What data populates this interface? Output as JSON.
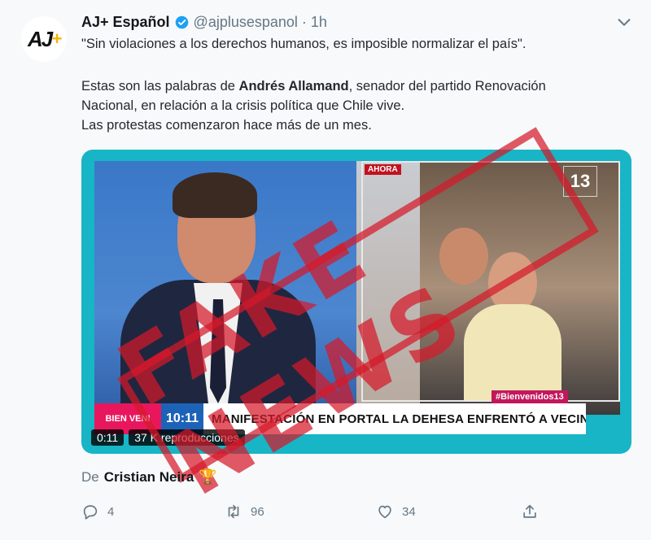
{
  "tweet": {
    "author_name": "AJ+ Español",
    "handle": "@ajplusespanol",
    "separator": "·",
    "time": "1h",
    "avatar_text": "AJ",
    "avatar_plus": "+",
    "line1": "\"Sin violaciones a los derechos humanos, es imposible normalizar el país\".",
    "line2_pre": "Estas son las palabras de ",
    "line2_bold": "Andrés Allamand",
    "line2_post": ", senador del partido Renovación",
    "line3": "Nacional, en relación a la crisis política que Chile vive.",
    "line4": "Las protestas comenzaron hace más de un mes."
  },
  "video": {
    "live_tag": "AHORA",
    "channel": "13",
    "hashtag": "#Bienvenidos13",
    "show_logo": "BIEN VENI",
    "clock": "10:11",
    "headline": "MANIFESTACIÓN EN PORTAL LA DEHESA ENFRENTÓ A VECINOS",
    "elapsed": "0:11",
    "views": "37 K reproducciones"
  },
  "stamp_text": "FAKE NEWS",
  "credit": {
    "prefix": "De",
    "name": "Cristian Neira",
    "emoji": "🏆"
  },
  "actions": {
    "reply_count": "4",
    "retweet_count": "96",
    "like_count": "34"
  },
  "icons": [
    "verified-badge-icon",
    "chevron-down-icon",
    "reply-icon",
    "retweet-icon",
    "like-icon",
    "share-icon"
  ],
  "colors": {
    "verified": "#1da1f2",
    "media_border": "#17b5c6",
    "stamp": "#d61929",
    "lower_third_pink": "#e8175d",
    "lower_third_blue": "#1c63b8"
  }
}
